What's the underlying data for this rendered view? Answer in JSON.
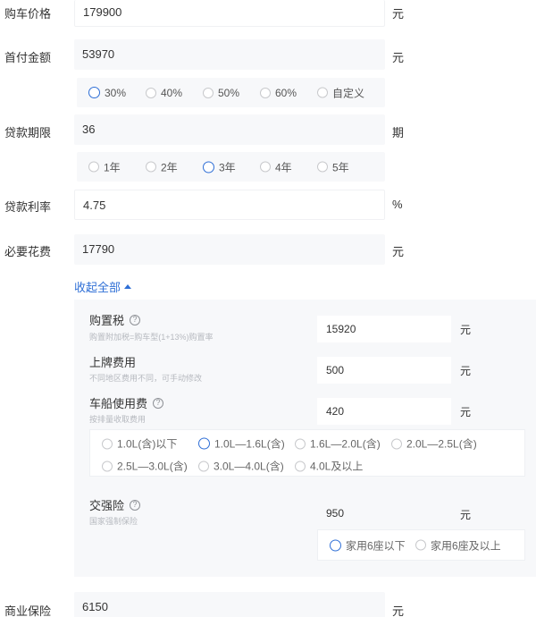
{
  "fields": {
    "price": {
      "label": "购车价格",
      "value": "179900",
      "unit": "元"
    },
    "down_payment": {
      "label": "首付金额",
      "value": "53970",
      "unit": "元"
    },
    "loan_term": {
      "label": "贷款期限",
      "value": "36",
      "unit": "期"
    },
    "interest_rate": {
      "label": "贷款利率",
      "value": "4.75",
      "unit": "%"
    },
    "required_fees": {
      "label": "必要花费",
      "value": "17790",
      "unit": "元"
    },
    "commercial_insurance": {
      "label": "商业保险",
      "value": "6150",
      "unit": "元"
    }
  },
  "down_payment_options": {
    "items": [
      "30%",
      "40%",
      "50%",
      "60%",
      "自定义"
    ],
    "selected": "30%"
  },
  "loan_term_options": {
    "items": [
      "1年",
      "2年",
      "3年",
      "4年",
      "5年"
    ],
    "selected": "3年"
  },
  "collapse_label": "收起全部",
  "fee_details": {
    "purchase_tax": {
      "label": "购置税",
      "help": "?",
      "subtitle": "购置附加税=购车型(1+13%)购置率",
      "value": "15920",
      "unit": "元"
    },
    "plate_fee": {
      "label": "上牌费用",
      "subtitle": "不同地区费用不同，可手动修改",
      "value": "500",
      "unit": "元"
    },
    "vehicle_tax": {
      "label": "车船使用费",
      "help": "?",
      "subtitle": "按排量收取费用",
      "value": "420",
      "unit": "元"
    },
    "compulsory_insurance": {
      "label": "交强险",
      "help": "?",
      "subtitle": "国家强制保险",
      "value": "950",
      "unit": "元"
    }
  },
  "displacement_options": {
    "items": [
      "1.0L(含)以下",
      "1.0L—1.6L(含)",
      "1.6L—2.0L(含)",
      "2.0L—2.5L(含)",
      "2.5L—3.0L(含)",
      "3.0L—4.0L(含)",
      "4.0L及以上"
    ],
    "selected": "1.0L—1.6L(含)"
  },
  "seat_options": {
    "items": [
      "家用6座以下",
      "家用6座及以上"
    ],
    "selected": "家用6座以下"
  },
  "colors": {
    "accent": "#2f6fd6",
    "field_bg": "#f7f8fa",
    "subtitle": "#b6b9bf"
  }
}
